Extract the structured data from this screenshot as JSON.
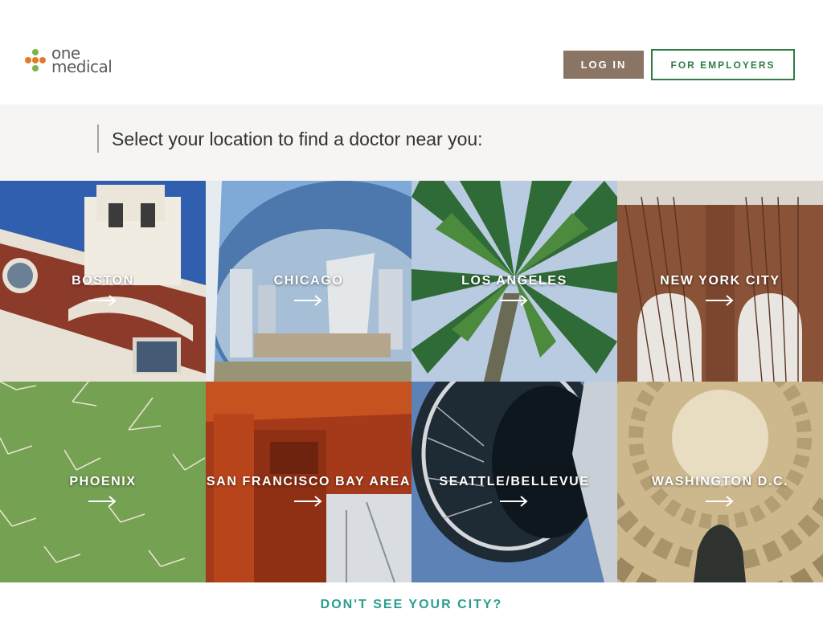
{
  "brand": {
    "name_line1": "one",
    "name_line2": "medical",
    "logo_colors": [
      "#e07b2a",
      "#7ab648",
      "#e07b2a",
      "#7ab648",
      "#e07b2a"
    ]
  },
  "header": {
    "login_label": "LOG IN",
    "employers_label": "FOR EMPLOYERS"
  },
  "prompt": {
    "text": "Select your location to find a doctor near you:"
  },
  "cities": [
    {
      "name": "BOSTON",
      "icon": "arrow-right-icon"
    },
    {
      "name": "CHICAGO",
      "icon": "arrow-right-icon"
    },
    {
      "name": "LOS ANGELES",
      "icon": "arrow-right-icon"
    },
    {
      "name": "NEW YORK CITY",
      "icon": "arrow-right-icon"
    },
    {
      "name": "PHOENIX",
      "icon": "arrow-right-icon"
    },
    {
      "name": "SAN FRANCISCO BAY AREA",
      "icon": "arrow-right-icon"
    },
    {
      "name": "SEATTLE/BELLEVUE",
      "icon": "arrow-right-icon"
    },
    {
      "name": "WASHINGTON D.C.",
      "icon": "arrow-right-icon"
    }
  ],
  "footer": {
    "dont_see_label": "DON'T SEE YOUR CITY?"
  },
  "colors": {
    "accent_brown": "#8a7463",
    "accent_green": "#2f7d43",
    "link_teal": "#2a9d8f"
  }
}
